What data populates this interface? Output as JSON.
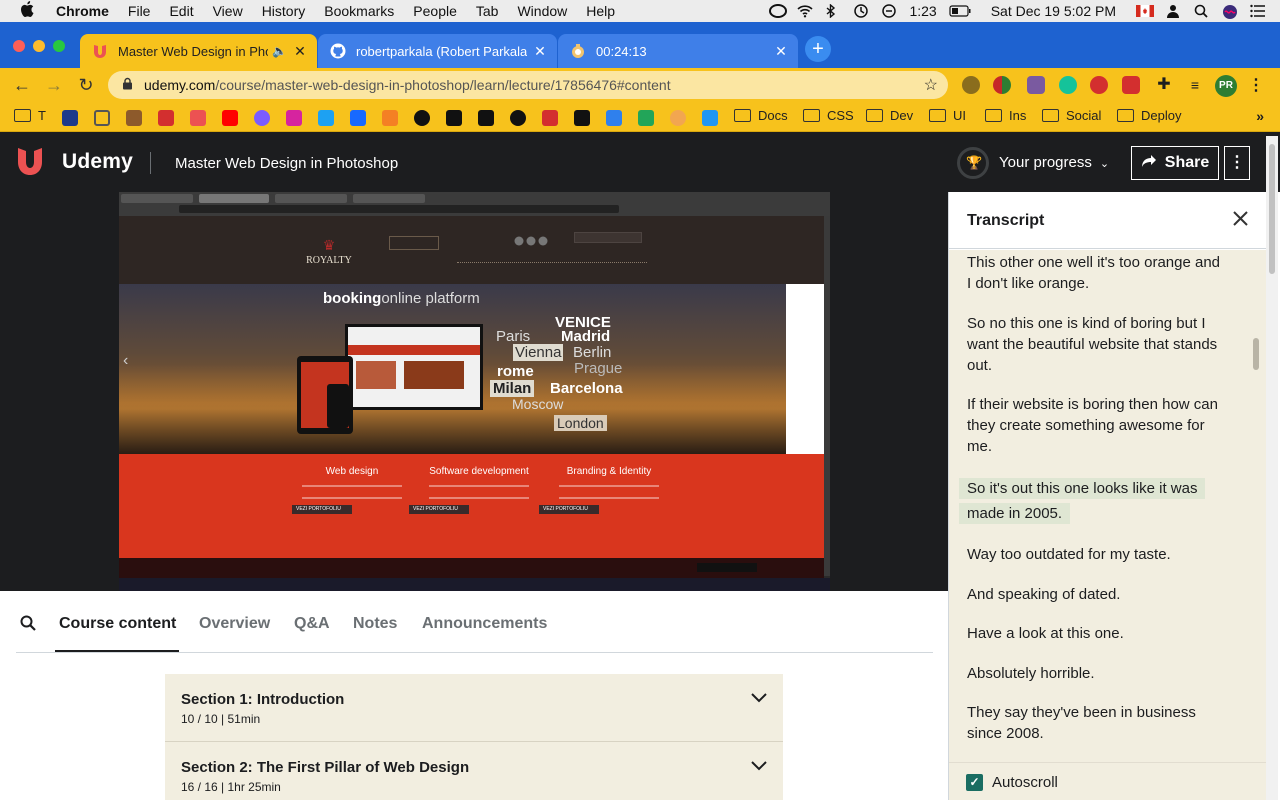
{
  "mac_menu": {
    "apple": "",
    "items": [
      "Chrome",
      "File",
      "Edit",
      "View",
      "History",
      "Bookmarks",
      "People",
      "Tab",
      "Window",
      "Help"
    ],
    "clock_small": "1:23",
    "datetime": "Sat Dec 19  5:02 PM"
  },
  "browser": {
    "tabs": [
      {
        "title": "Master Web Design in Phot",
        "favicon_color": "#ec5252",
        "active": true
      },
      {
        "title": "robertparkala (Robert Parkala)",
        "favicon_color": "#ffffff",
        "active": false
      },
      {
        "title": "00:24:13",
        "favicon_color": "#f2c46e",
        "active": false
      }
    ],
    "new_tab": "+",
    "url_host": "udemy.com",
    "url_path": "/course/master-web-design-in-photoshop/learn/lecture/17856476#content",
    "profile_initials": "PR",
    "bookmark_folders": [
      "Docs",
      "CSS",
      "Dev",
      "UI",
      "Ins",
      "Social",
      "Deploy"
    ],
    "bookmark_first": "T",
    "bookmarks_more": "»"
  },
  "udemy": {
    "logo": "Udemy",
    "course_title": "Master Web Design in Photoshop",
    "progress_label": "Your progress",
    "share_label": "Share",
    "more_label": "⋮"
  },
  "video": {
    "site_logo": "ROYALTY",
    "hero_bold": "booking",
    "hero_light": "online platform",
    "cities": [
      "VENICE",
      "Paris",
      "Madrid",
      "Vienna",
      "Berlin",
      "Prague",
      "rome",
      "Milan",
      "Barcelona",
      "Moscow",
      "London"
    ],
    "services": [
      {
        "title": "Web design",
        "button": "VEZI PORTOFOLIU"
      },
      {
        "title": "Software development",
        "button": "VEZI PORTOFOLIU"
      },
      {
        "title": "Branding & Identity",
        "button": "VEZI PORTOFOLIU"
      }
    ]
  },
  "course_tabs": [
    "Course content",
    "Overview",
    "Q&A",
    "Notes",
    "Announcements"
  ],
  "sections": [
    {
      "title": "Section 1: Introduction",
      "meta": "10 / 10 | 51min"
    },
    {
      "title": "Section 2: The First Pillar of Web Design",
      "meta": "16 / 16 | 1hr 25min"
    }
  ],
  "transcript": {
    "title": "Transcript",
    "cues": [
      "This other one well it's too orange and I don't like orange.",
      "So no this one is kind of boring but I want the beautiful website that stands out.",
      "If their website is boring then how can they create something awesome for me.",
      "So it's out this one looks like it was made in 2005.",
      "Way too outdated for my taste.",
      "And speaking of dated.",
      "Have a look at this one.",
      "Absolutely horrible.",
      "They say they've been in business since 2008."
    ],
    "highlighted_index": 3,
    "autoscroll_label": "Autoscroll",
    "autoscroll_checked": true
  }
}
